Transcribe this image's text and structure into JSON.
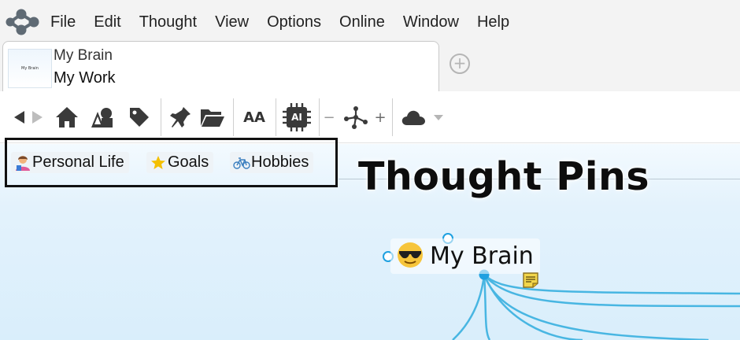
{
  "menu": {
    "items": [
      "File",
      "Edit",
      "Thought",
      "View",
      "Options",
      "Online",
      "Window",
      "Help"
    ]
  },
  "tab": {
    "thumbnail_text": "My Brain",
    "brain_name": "My Brain",
    "thought_name": "My Work"
  },
  "toolbar": {
    "font_button": "AA",
    "ai_button": "AI",
    "zoom_minus": "−",
    "zoom_plus": "+"
  },
  "pins": {
    "items": [
      {
        "label": "Personal Life",
        "icon": "person-icon"
      },
      {
        "label": "Goals",
        "icon": "star-icon"
      },
      {
        "label": "Hobbies",
        "icon": "bicycle-icon"
      }
    ]
  },
  "overlay": {
    "title": "Thought Pins"
  },
  "node": {
    "label": "My Brain",
    "icon": "sunglasses-emoji-icon"
  },
  "colors": {
    "accent": "#1ea0e0",
    "link": "#48b6e2",
    "canvas_top": "#f3faff",
    "canvas_bottom": "#d9eefb",
    "note": "#f2d64b"
  }
}
